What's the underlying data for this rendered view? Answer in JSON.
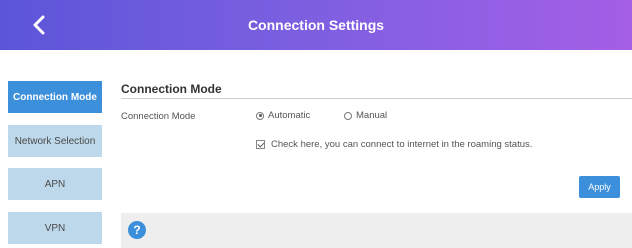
{
  "header": {
    "title": "Connection Settings",
    "back_icon": "chevron-left-icon"
  },
  "sidebar": {
    "items": [
      {
        "label": "Connection Mode",
        "active": true
      },
      {
        "label": "Network Selection",
        "active": false
      },
      {
        "label": "APN",
        "active": false
      },
      {
        "label": "VPN",
        "active": false
      }
    ]
  },
  "main": {
    "section_title": "Connection Mode",
    "connection_mode_label": "Connection Mode",
    "radio_automatic": "Automatic",
    "radio_manual": "Manual",
    "selected_mode": "Automatic",
    "roaming_checkbox_label": "Check here, you can connect to internet in the roaming status.",
    "roaming_checked": true,
    "apply_label": "Apply"
  },
  "help": {
    "icon": "help-icon",
    "symbol": "?"
  },
  "colors": {
    "accent": "#3c8fdb",
    "header_start": "#5c55d8",
    "header_end": "#a45fe6",
    "sidebar_inactive": "#bcd8ea"
  }
}
